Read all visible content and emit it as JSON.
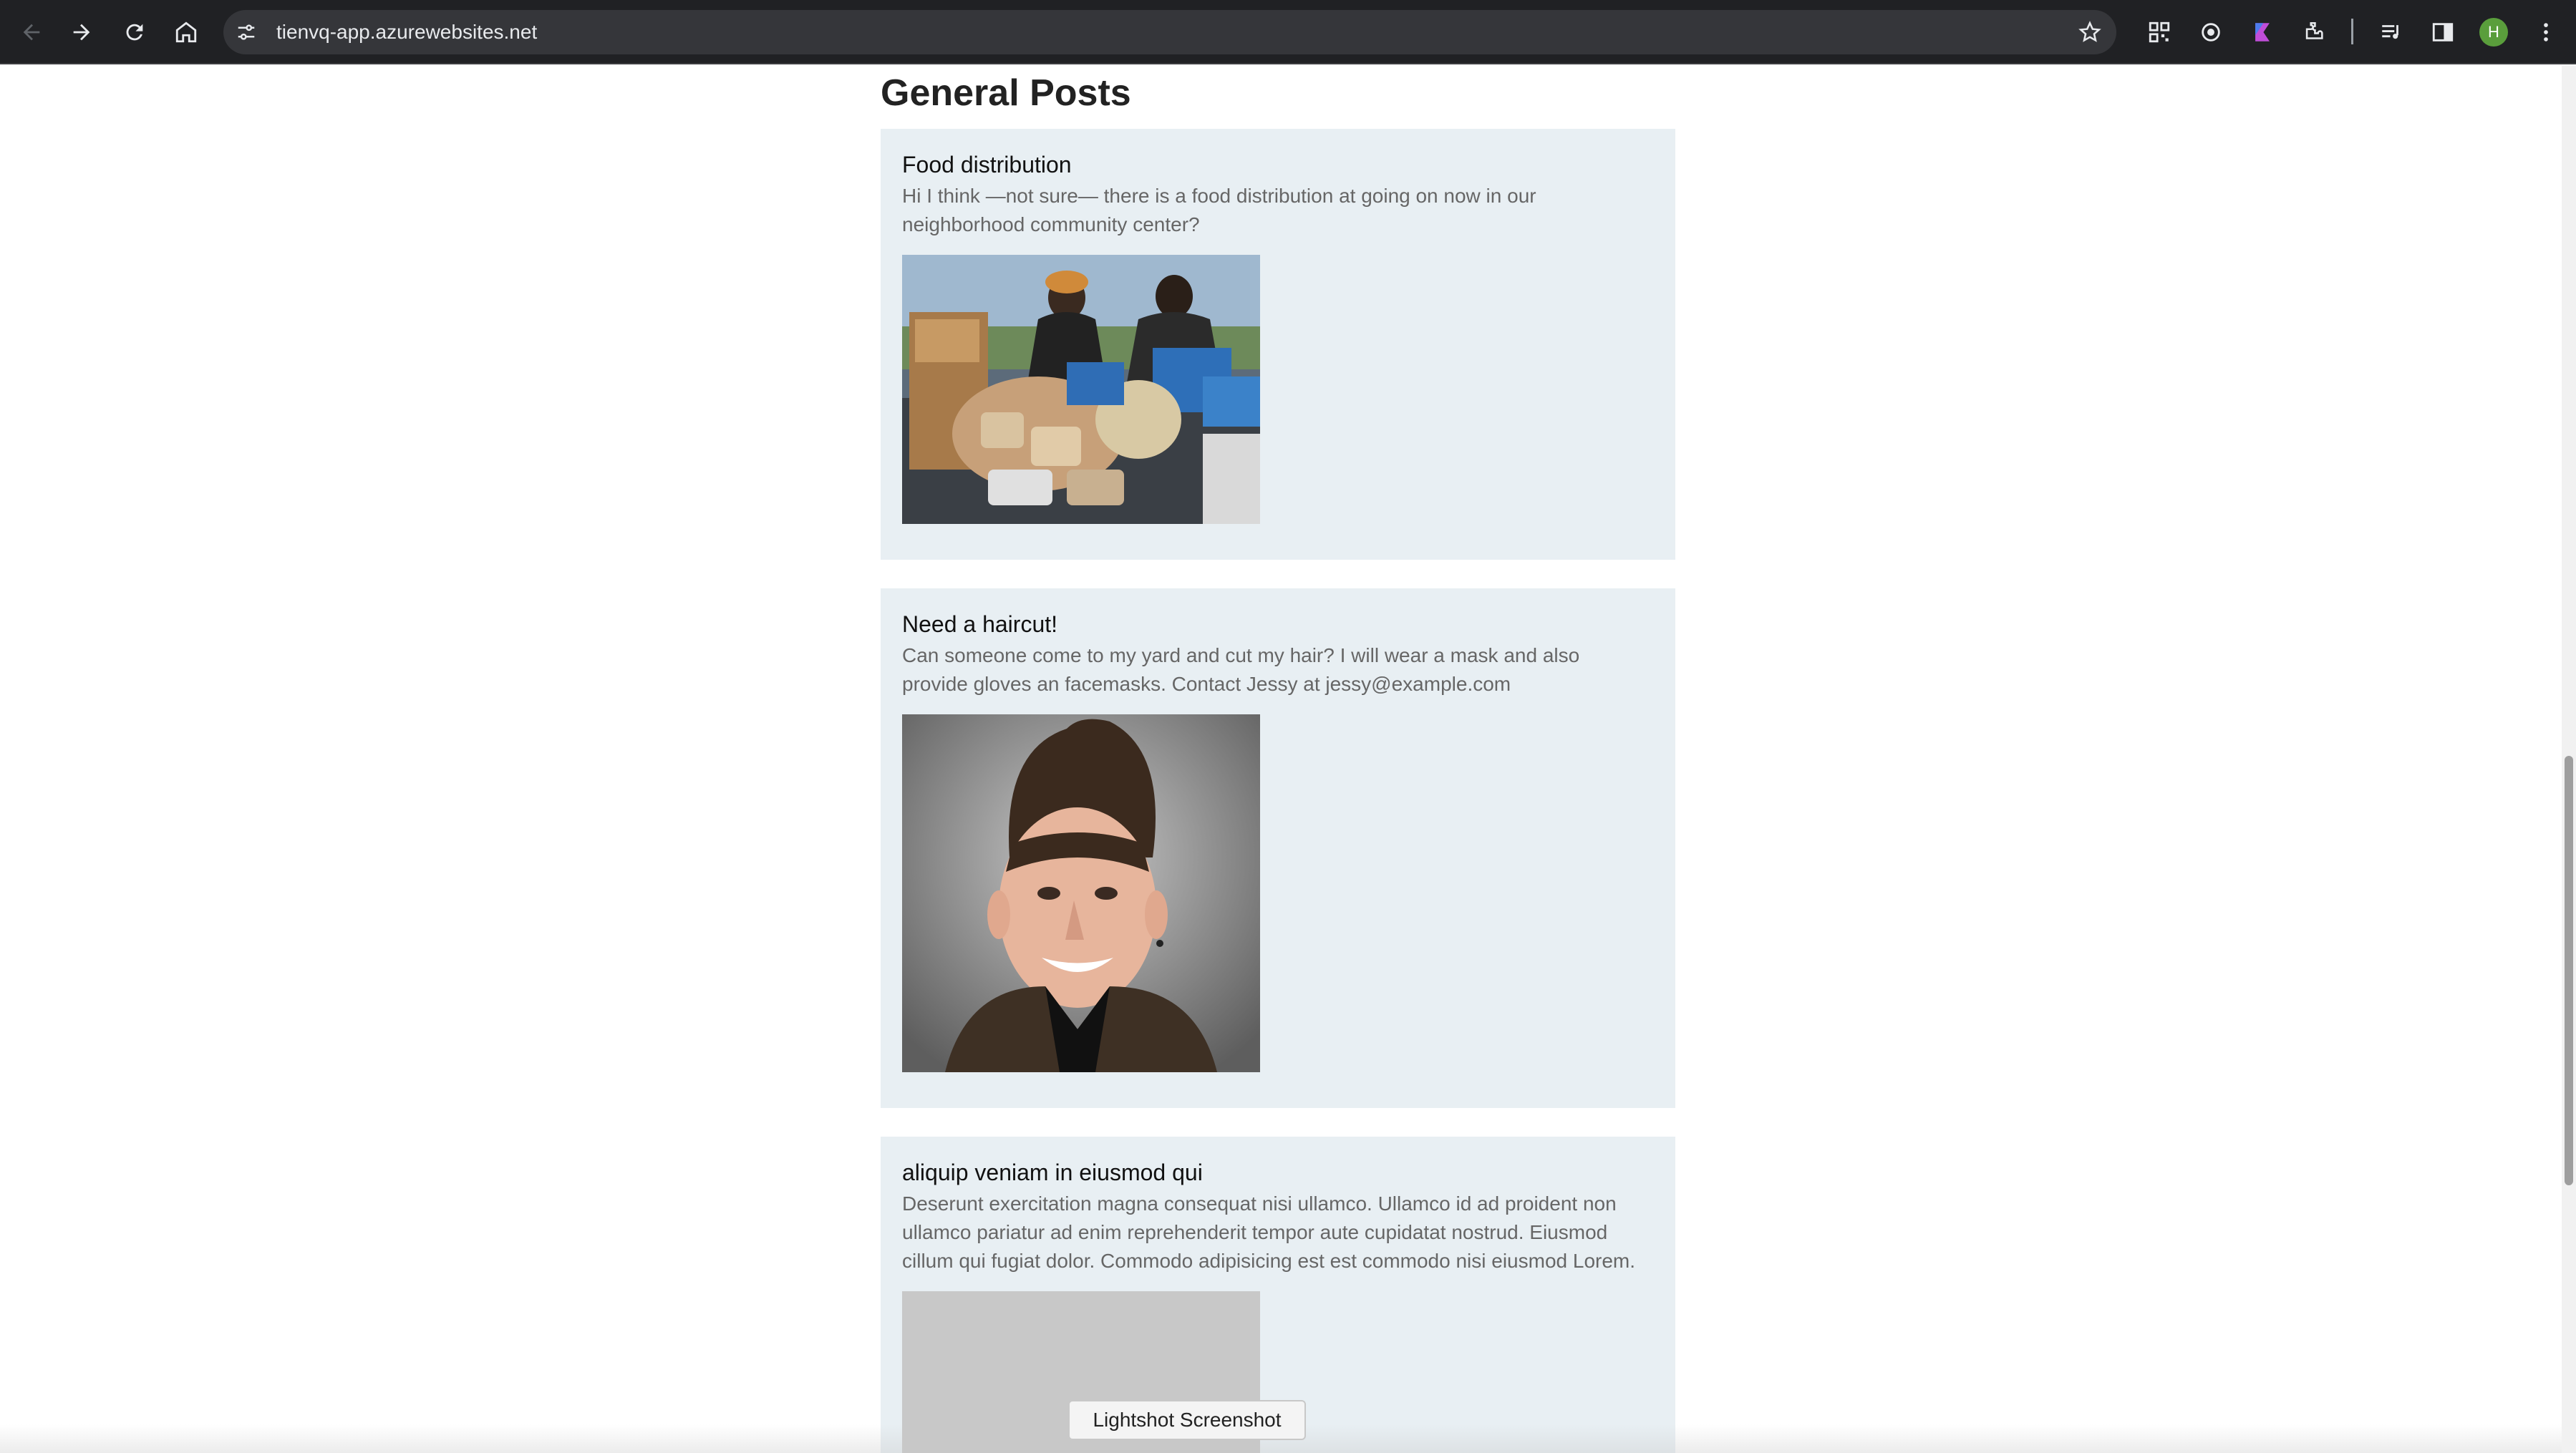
{
  "browser": {
    "url": "tienvq-app.azurewebsites.net",
    "profile_initial": "H",
    "icons": {
      "back": "arrow-left-icon",
      "forward": "arrow-right-icon",
      "reload": "reload-icon",
      "home": "home-icon",
      "site_info": "tune-icon",
      "bookmark": "star-icon",
      "extensions": [
        "qr-code-icon",
        "target-icon",
        "flag-icon",
        "puzzle-icon",
        "media-queue-icon",
        "side-panel-icon"
      ],
      "menu": "more-vert-icon"
    }
  },
  "page": {
    "section_title": "General Posts",
    "posts": [
      {
        "title": "Food distribution",
        "body": "Hi I think —not sure— there is a food distribution at going on now in our neighborhood community center?",
        "image": "food-distribution-photo"
      },
      {
        "title": "Need a haircut!",
        "body": "Can someone come to my yard and cut my hair? I will wear a mask and also provide gloves an facemasks. Contact Jessy at jessy@example.com",
        "image": "haircut-portrait-photo"
      },
      {
        "title": "aliquip veniam in eiusmod qui",
        "body": "Deserunt exercitation magna consequat nisi ullamco. Ullamco id ad proident non ullamco pariatur ad enim reprehenderit tempor aute cupidatat nostrud. Eiusmod cillum qui fugiat dolor. Commodo adipisicing est est commodo nisi eiusmod Lorem.",
        "image": "placeholder-image"
      }
    ]
  },
  "overlay": {
    "tooltip": "Lightshot Screenshot"
  },
  "colors": {
    "chrome_bg": "#202124",
    "omnibox_bg": "#35363a",
    "post_bg": "#e8eff3",
    "avatar": "#5a9e3c"
  }
}
